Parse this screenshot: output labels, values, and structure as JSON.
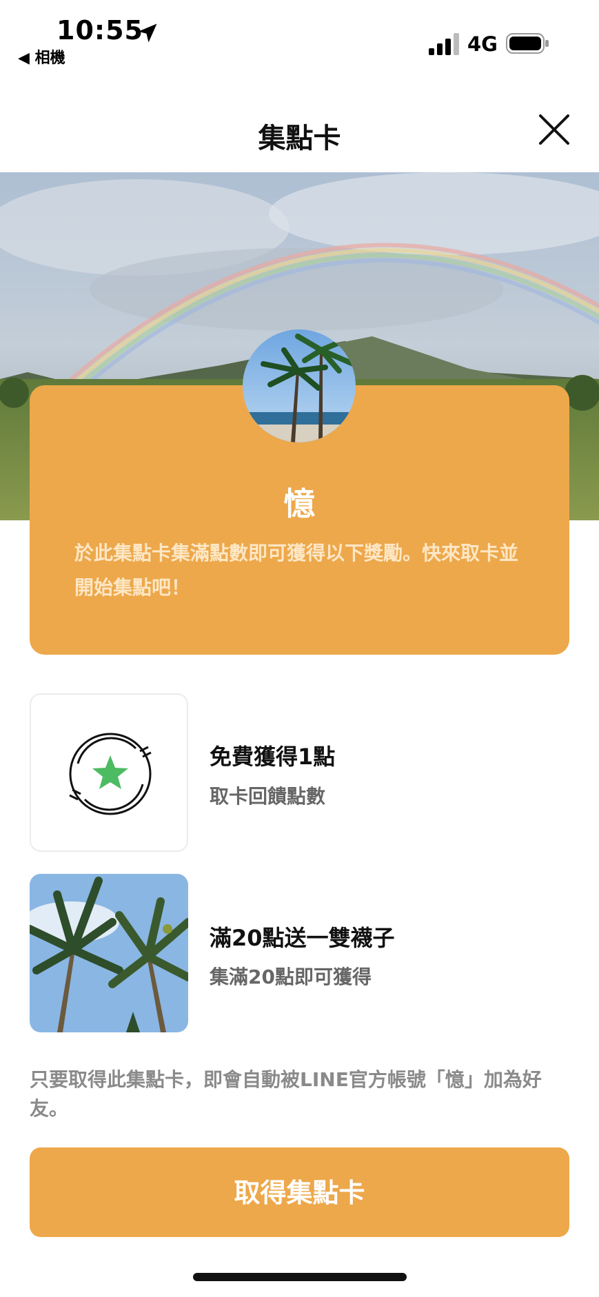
{
  "status_bar": {
    "time": "10:55",
    "back_app": "◀ 相機",
    "network": "4G",
    "location_icon": "location-arrow-icon",
    "signal_icon": "signal-bars-icon",
    "battery_icon": "battery-icon"
  },
  "header": {
    "title": "集點卡",
    "close_icon": "close-icon"
  },
  "card": {
    "name": "憶",
    "description": "於此集點卡集滿點數即可獲得以下獎勵。快來取卡並開始集點吧！",
    "accent_color": "#eda84b"
  },
  "rewards": [
    {
      "title": "免費獲得1點",
      "subtitle": "取卡回饋點數",
      "icon": "star-stamp-icon"
    },
    {
      "title": "滿20點送一雙襪子",
      "subtitle": "集滿20點即可獲得",
      "icon": "palm-tree-photo"
    }
  ],
  "notice": "只要取得此集點卡，即會自動被LINE官方帳號「憶」加為好友。",
  "cta": {
    "label": "取得集點卡"
  }
}
